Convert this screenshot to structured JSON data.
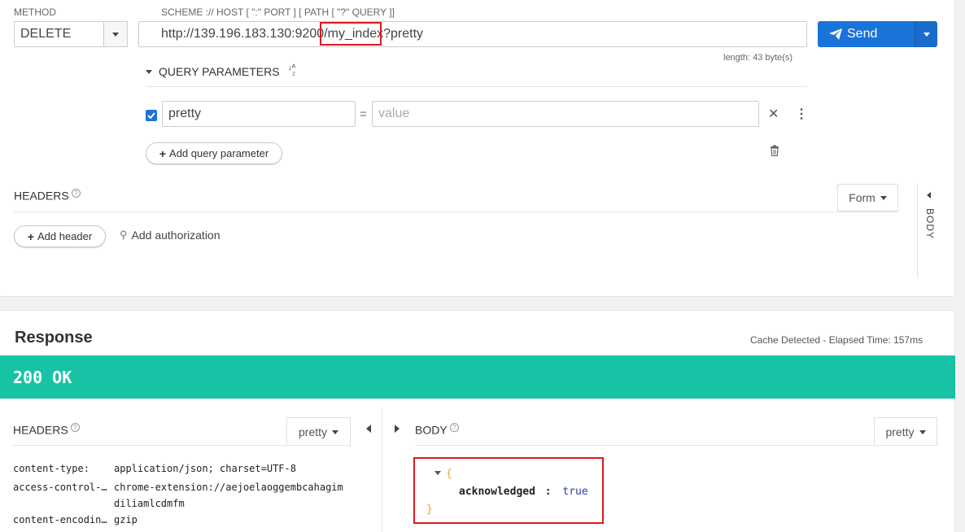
{
  "request": {
    "method_label": "METHOD",
    "method_value": "DELETE",
    "url_hint": "SCHEME :// HOST [ \":\" PORT ] [ PATH [ \"?\" QUERY ]]",
    "url_prefix": "http://139.196.183.130:9200",
    "url_path": "/my_index",
    "url_query": "?pretty",
    "length_text": "length: 43 byte(s)",
    "send_label": "Send",
    "query_params_label": "QUERY PARAMETERS",
    "sort_icon_text": "↓A Z",
    "param_name": "pretty",
    "param_equals": "=",
    "param_value_placeholder": "value",
    "add_query_param_label": "Add query parameter",
    "headers_label": "HEADERS",
    "form_label": "Form",
    "add_header_label": "Add header",
    "add_auth_label": "Add authorization",
    "body_side_label": "BODY"
  },
  "response": {
    "title": "Response",
    "cache_text": "Cache Detected - Elapsed Time: 157ms",
    "status": "200 OK",
    "status_color": "#18c3a5",
    "headers_label": "HEADERS",
    "headers_format": "pretty",
    "body_label": "BODY",
    "body_format": "pretty",
    "headers": [
      {
        "name": "content-type:",
        "value": "application/json; charset=UTF-8"
      },
      {
        "name": "access-control-…",
        "value": "chrome-extension://aejoelaoggembcahagim",
        "value2": "diliamlcdmfm"
      },
      {
        "name": "content-encodin…",
        "value": "gzip"
      }
    ],
    "json": {
      "open": "{",
      "key": "acknowledged",
      "sep": ":",
      "value": "true",
      "close": "}"
    }
  }
}
